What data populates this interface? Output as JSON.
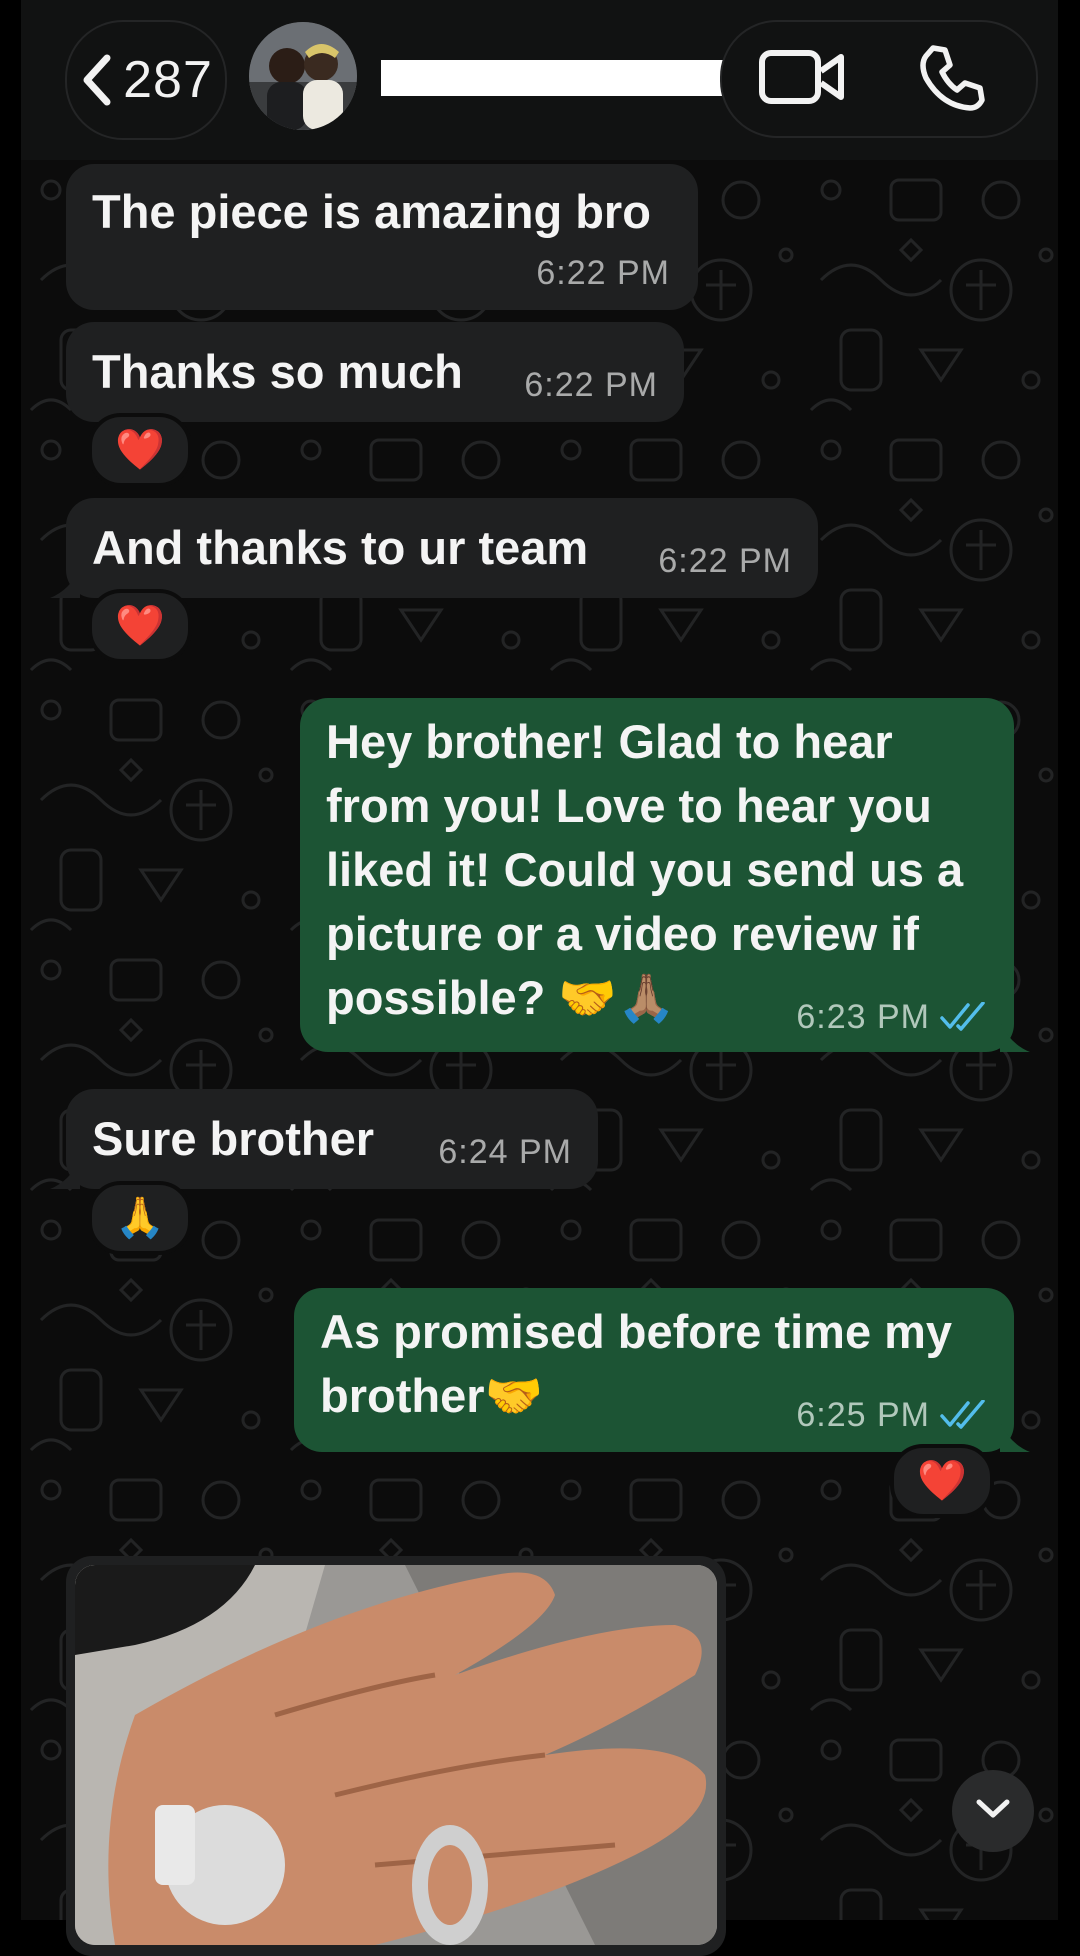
{
  "header": {
    "back_count": "287",
    "back_icon": "chevron-left-icon",
    "video_icon": "video-camera-icon",
    "call_icon": "phone-icon"
  },
  "messages": [
    {
      "direction": "in",
      "text": "The piece is amazing bro",
      "time": "6:22 PM"
    },
    {
      "direction": "in",
      "text": "Thanks so much",
      "time": "6:22 PM",
      "reaction": "❤️"
    },
    {
      "direction": "in",
      "text": "And thanks to ur team",
      "time": "6:22 PM",
      "reaction": "❤️"
    },
    {
      "direction": "out",
      "lines": [
        "Hey brother! Glad to hear",
        "from you! Love to hear you",
        "liked it! Could you send us a",
        "picture or a video review if",
        "possible? 🤝🙏🏽"
      ],
      "time": "6:23 PM",
      "status": "read"
    },
    {
      "direction": "in",
      "text": "Sure brother",
      "time": "6:24 PM",
      "reaction": "🙏"
    },
    {
      "direction": "out",
      "lines": [
        "As promised before time my",
        "brother🤝"
      ],
      "time": "6:25 PM",
      "status": "read",
      "reaction": "❤️"
    }
  ],
  "colors": {
    "incoming_bubble": "#1f2021",
    "outgoing_bubble": "#1c5434",
    "read_ticks": "#53bdeb",
    "header_bg": "#111212"
  },
  "scroll_down_icon": "chevron-down-icon"
}
